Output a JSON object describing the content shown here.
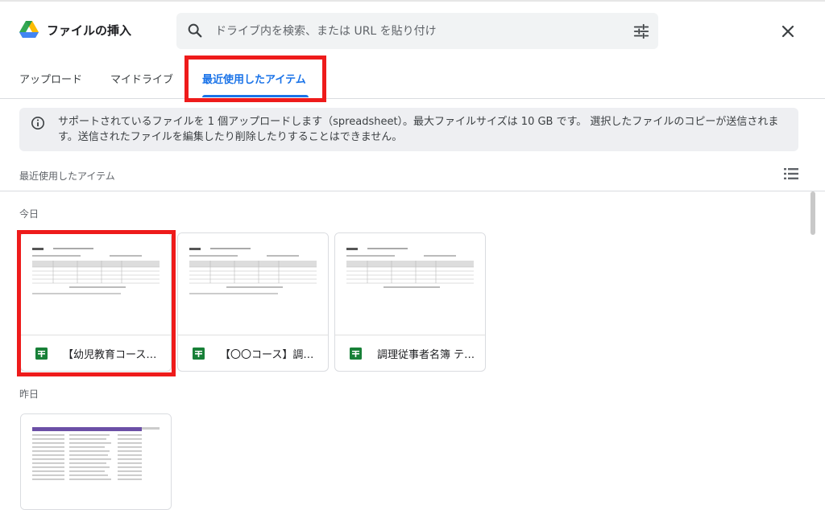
{
  "dialog": {
    "title": "ファイルの挿入",
    "search_placeholder": "ドライブ内を検索、または URL を貼り付け"
  },
  "tabs": [
    {
      "label": "アップロード",
      "active": false
    },
    {
      "label": "マイドライブ",
      "active": false
    },
    {
      "label": "最近使用したアイテム",
      "active": true
    }
  ],
  "info": {
    "text": "サポートされているファイルを 1 個アップロードします（spreadsheet）。最大ファイルサイズは 10 GB です。 選択したファイルのコピーが送信されます。送信されたファイルを編集したり削除したりすることはできません。"
  },
  "section": {
    "title": "最近使用したアイテム"
  },
  "groups": [
    {
      "label": "今日",
      "files": [
        {
          "name": "【幼児教育コース＋…"
        },
        {
          "name": "【〇〇コース】調理…"
        },
        {
          "name": "調理従事者名簿 テン…"
        }
      ]
    },
    {
      "label": "昨日",
      "files": [
        {
          "name": ""
        }
      ]
    }
  ],
  "colors": {
    "accent": "#1a73e8",
    "highlight": "#ee1b1b",
    "sheets_green": "#188038"
  }
}
